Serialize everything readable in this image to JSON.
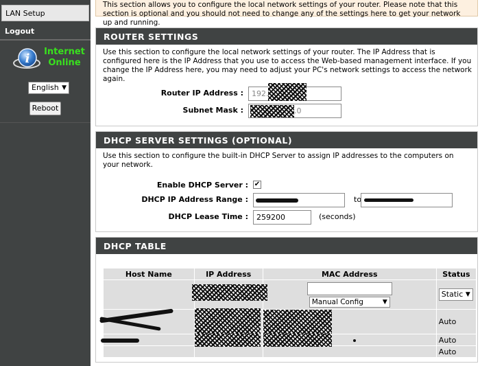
{
  "sidebar": {
    "lan_setup": "LAN Setup",
    "logout": "Logout",
    "status": {
      "line1": "Internet",
      "line2": "Online",
      "icon": "info-globe-icon"
    },
    "language": "English",
    "reboot": "Reboot"
  },
  "intro": {
    "text": "This section allows you to configure the local network settings of your router. Please note that this section is optional and you should not need to change any of the settings here to get your network up and running."
  },
  "router": {
    "title": "ROUTER SETTINGS",
    "desc": "Use this section to configure the local network settings of your router. The IP Address that is configured here is the IP Address that you use to access the Web-based management interface. If you change the IP Address here, you may need to adjust your PC's network settings to access the network again.",
    "ip_label": "Router IP Address :",
    "ip_value": "192.",
    "mask_label": "Subnet Mask :",
    "mask_value": ".0"
  },
  "dhcp": {
    "title": "DHCP SERVER SETTINGS (OPTIONAL)",
    "desc": "Use this section to configure the built-in DHCP Server to assign IP addresses to the computers on your network.",
    "enable_label": "Enable DHCP Server :",
    "enable_checked": true,
    "range_label": "DHCP IP Address Range :",
    "range_to": "to",
    "lease_label": "DHCP Lease Time :",
    "lease_value": "259200",
    "lease_unit": "(seconds)"
  },
  "table": {
    "title": "DHCP TABLE",
    "headers": [
      "Host Name",
      "IP Address",
      "MAC Address",
      "Status"
    ],
    "config_row": {
      "mac_mode": "Manual Config",
      "status": "Static"
    },
    "rows": [
      {
        "status": "Auto"
      },
      {
        "status": "Auto"
      },
      {
        "status": "Auto"
      }
    ]
  },
  "colors": {
    "sidebar_bg": "#404343",
    "header_bg": "#404343",
    "online_green": "#39e01e",
    "intro_bg": "#fdf0e0",
    "table_cell": "#dedede"
  }
}
